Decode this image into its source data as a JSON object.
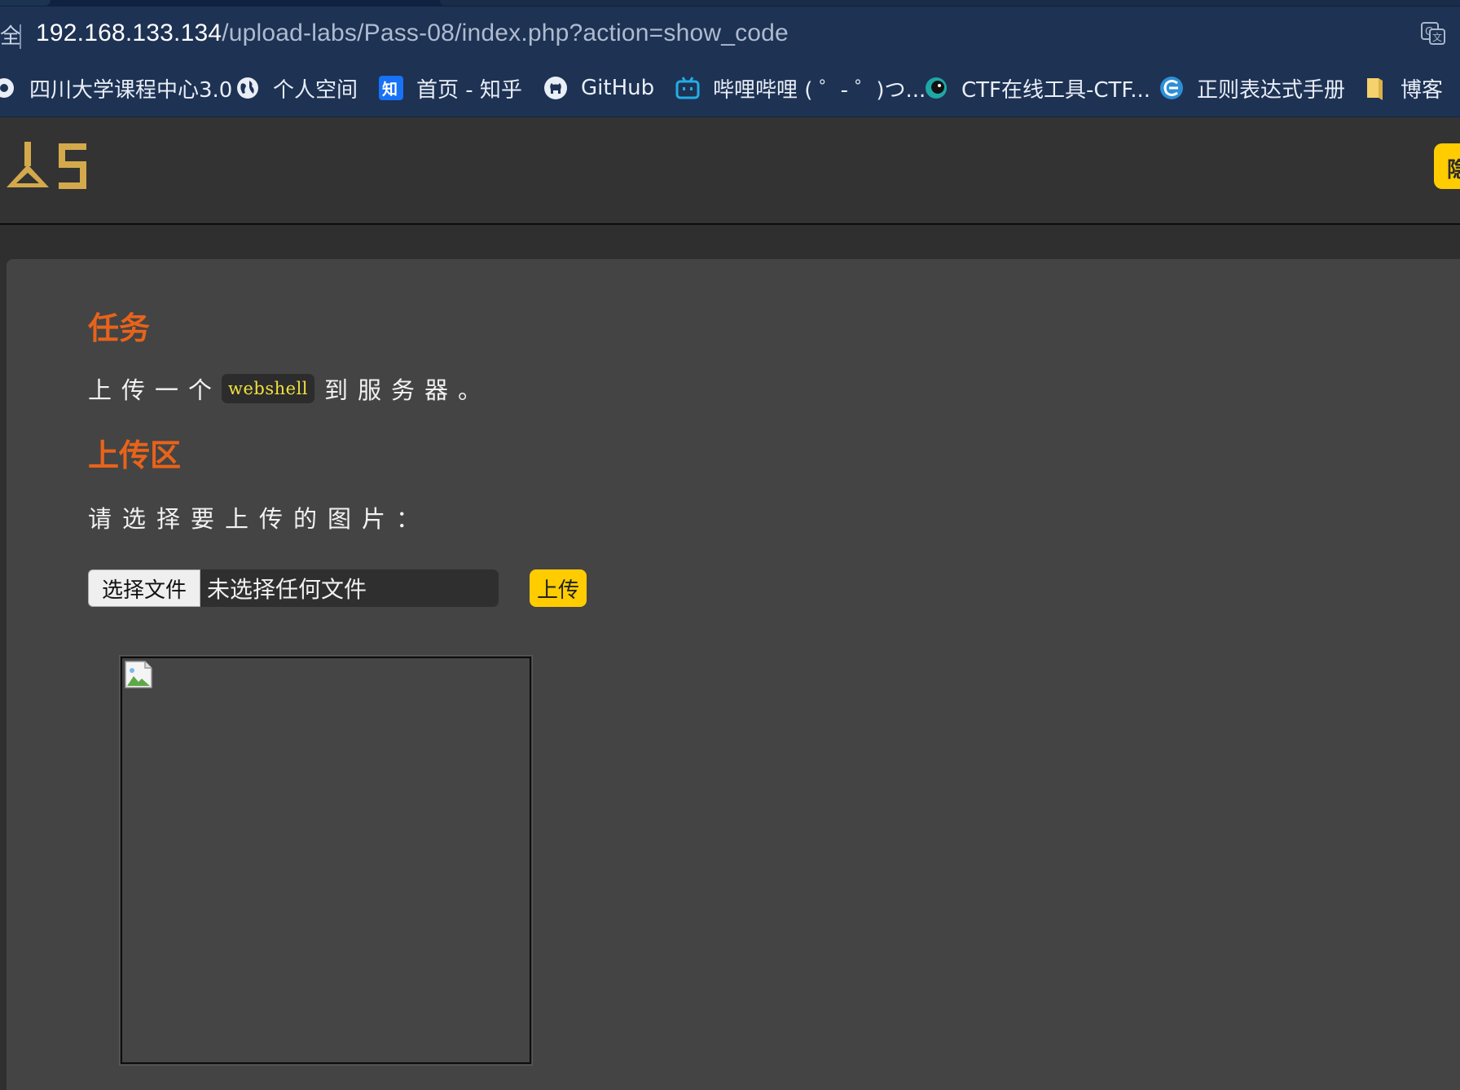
{
  "browser": {
    "url_host": "192.168.133.134",
    "url_path": "/upload-labs/Pass-08/index.php?action=show_code",
    "lock_fragment": "全",
    "bookmarks": [
      {
        "label": "四川大学课程中心3.0",
        "icon": "scu-icon"
      },
      {
        "label": "个人空间",
        "icon": "globe-icon"
      },
      {
        "label": "首页 - 知乎",
        "icon": "zhihu-icon"
      },
      {
        "label": "GitHub",
        "icon": "github-icon"
      },
      {
        "label": "哔哩哔哩 ( ゜- ゜)つ...",
        "icon": "bilibili-icon"
      },
      {
        "label": "CTF在线工具-CTF...",
        "icon": "ctf-icon"
      },
      {
        "label": "正则表达式手册",
        "icon": "regex-icon"
      },
      {
        "label": "博客",
        "icon": "folder-icon"
      }
    ]
  },
  "header": {
    "logo_text": "LS",
    "right_button_label": "隐"
  },
  "main": {
    "task_heading": "任务",
    "task_text_before": "上传一个",
    "task_code": "webshell",
    "task_text_after": "到服务器。",
    "upload_heading": "上传区",
    "prompt": "请选择要上传的图片：",
    "choose_file_label": "选择文件",
    "no_file_text": "未选择任何文件",
    "upload_button_label": "上传"
  },
  "colors": {
    "accent_orange": "#e8631a",
    "button_yellow": "#ffcc00",
    "code_yellow": "#f0e040",
    "logo_gold": "#d4a94c"
  }
}
